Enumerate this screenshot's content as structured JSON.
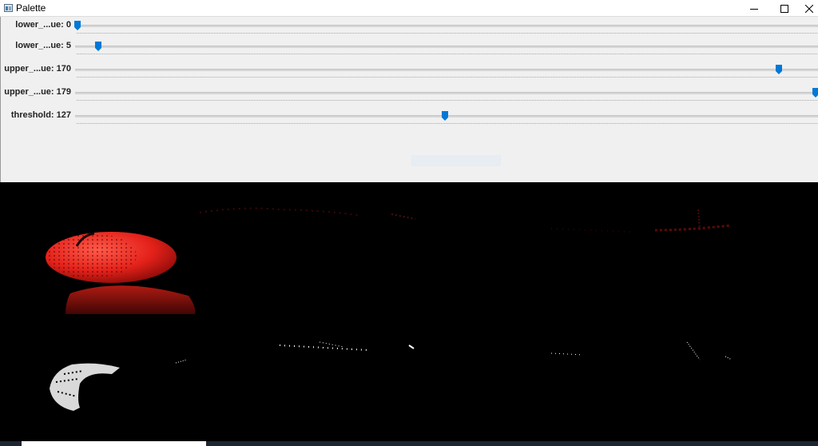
{
  "window": {
    "title": "Palette",
    "icon": "app-window-icon",
    "controls": [
      "minimize-icon",
      "maximize-icon",
      "close-icon"
    ]
  },
  "sliders": [
    {
      "label": "lower_...ue: 0",
      "value": 0,
      "max": 179
    },
    {
      "label": "lower_...ue: 5",
      "value": 5,
      "max": 179
    },
    {
      "label": "upper_...ue: 170",
      "value": 170,
      "max": 179
    },
    {
      "label": "upper_...ue: 179",
      "value": 179,
      "max": 179
    },
    {
      "label": "threshold: 127",
      "value": 127,
      "max": 255
    }
  ],
  "colors": {
    "slider_thumb": "#0078d7",
    "panel_bg": "#f0f0f0",
    "tomato_red": "#e8231d",
    "mask_white": "#ffffff",
    "canvas_bg": "#000000"
  },
  "images": {
    "top": "color-filtered-tomato",
    "bottom": "binary-threshold-mask"
  }
}
